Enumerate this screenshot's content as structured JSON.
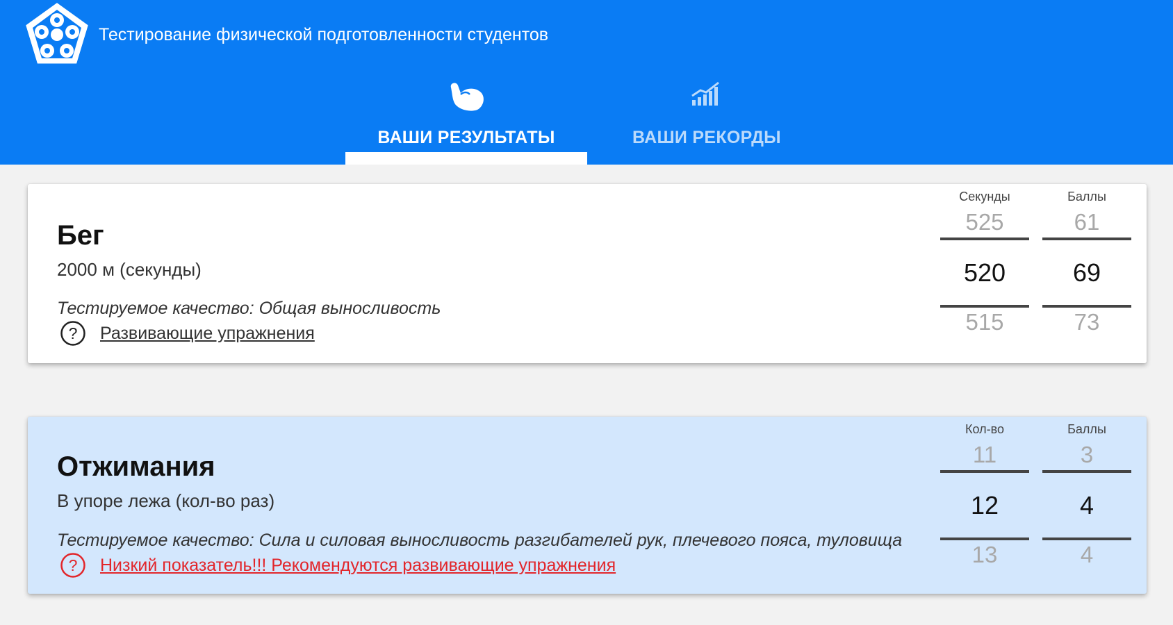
{
  "header": {
    "title": "Тестирование физической подготовленности студентов",
    "accent_color": "#0a7cf4",
    "logo_icon": "pentagon-sport-logo",
    "tabs": [
      {
        "label": "ВАШИ РЕЗУЛЬТАТЫ",
        "icon": "flexed-arm-icon",
        "active": true
      },
      {
        "label": "ВАШИ РЕКОРДЫ",
        "icon": "signal-bars-icon",
        "active": false
      }
    ]
  },
  "cards": [
    {
      "title": "Бег",
      "subtitle": "2000 м (секунды)",
      "quality": "Тестируемое качество: Общая выносливость",
      "link": "Развивающие упражнения",
      "link_color": "#333333",
      "highlight": false,
      "columns": [
        {
          "header": "Секунды",
          "prev": "525",
          "current": "520",
          "next": "515"
        },
        {
          "header": "Баллы",
          "prev": "61",
          "current": "69",
          "next": "73"
        }
      ]
    },
    {
      "title": "Отжимания",
      "subtitle": "В упоре лежа  (кол-во раз)",
      "quality": "Тестируемое качество: Сила и силовая выносливость разгибателей рук, плечевого пояса, туловища",
      "link": "Низкий показатель!!! Рекомендуются развивающие упражнения",
      "link_color": "#e2262b",
      "highlight": true,
      "highlight_color": "#d3e7fd",
      "columns": [
        {
          "header": "Кол-во",
          "prev": "11",
          "current": "12",
          "next": "13"
        },
        {
          "header": "Баллы",
          "prev": "3",
          "current": "4",
          "next": "4"
        }
      ]
    }
  ]
}
